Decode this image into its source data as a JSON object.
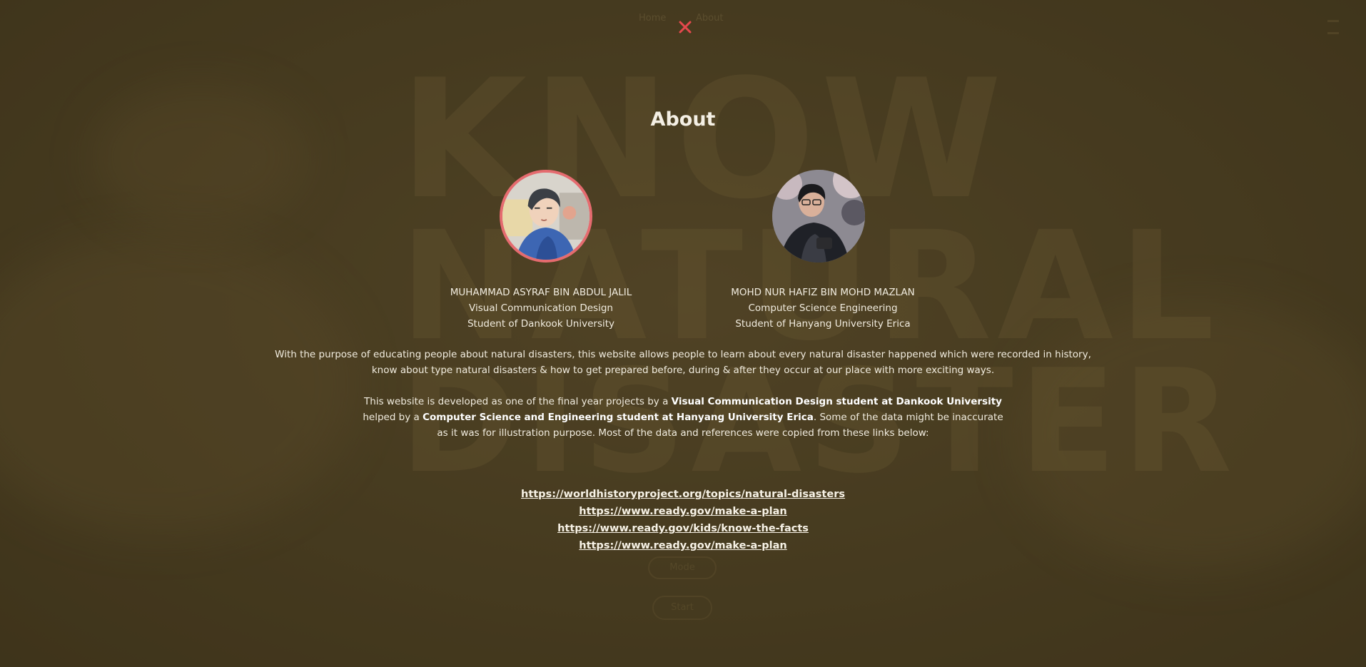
{
  "colors": {
    "background": "#4e4224",
    "text": "#f1ecdf",
    "close_accent": "#e5484d",
    "avatar_ring": "#e56b6f"
  },
  "modal": {
    "close_icon": "close-icon",
    "title": "About"
  },
  "team": [
    {
      "avatar_icon": "illustrated-portrait",
      "name": "MUHAMMAD ASYRAF BIN ABDUL JALIL",
      "program": "Visual Communication Design",
      "school": "Student of Dankook University"
    },
    {
      "avatar_icon": "photo-portrait",
      "name": "MOHD NUR HAFIZ BIN MOHD MAZLAN",
      "program": "Computer Science Engineering",
      "school": "Student of Hanyang University Erica"
    }
  ],
  "description": {
    "line1": "With the purpose of educating people about natural disasters, this website allows people to learn about every natural disaster happened which were recorded in history,",
    "line2": "know about type natural disasters & how to get prepared before, during & after they occur at our place with more exciting ways."
  },
  "credits": {
    "p1": "This website is developed as one of the final year projects by a ",
    "b1": "Visual Communication Design student at Dankook University",
    "p2": "helped by a ",
    "b2": "Computer Science and Engineering student at Hanyang University Erica",
    "p3": ". Some of the data might be inaccurate",
    "p4": "as it was for illustration purpose. Most of the data and references were copied from these links below:"
  },
  "links": [
    "https://worldhistoryproject.org/topics/natural-disasters",
    "https://www.ready.gov/make-a-plan",
    "https://www.ready.gov/kids/know-the-facts",
    "https://www.ready.gov/make-a-plan"
  ],
  "background": {
    "title_line1": "KNOW",
    "title_line2": "NATURAL",
    "title_line3": "DISASTER",
    "nav_left": "Home",
    "nav_right": "About",
    "pill_1": "Mode",
    "pill_2": "Start",
    "menu_icon": "hamburger-menu-icon"
  }
}
